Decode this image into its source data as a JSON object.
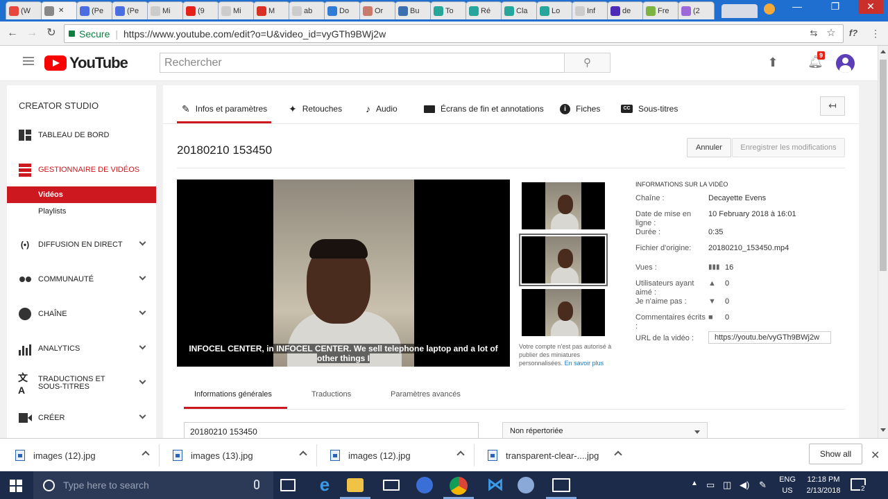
{
  "browser": {
    "tabs": [
      {
        "label": "(W",
        "color": "#e8453c"
      },
      {
        "label": "",
        "color": "#888888"
      },
      {
        "label": "(Pe",
        "color": "#4a6ee0"
      },
      {
        "label": "(Pe",
        "color": "#4a6ee0"
      },
      {
        "label": "Mi",
        "color": "#cccccc"
      },
      {
        "label": "(9",
        "color": "#e62117"
      },
      {
        "label": "Mi",
        "color": "#cccccc"
      },
      {
        "label": "M",
        "color": "#d93025"
      },
      {
        "label": "ab",
        "color": "#cccccc"
      },
      {
        "label": "Do",
        "color": "#2f7bd6"
      },
      {
        "label": "Or",
        "color": "#c97a6a"
      },
      {
        "label": "Bu",
        "color": "#3a6fb0"
      },
      {
        "label": "To",
        "color": "#26a69a"
      },
      {
        "label": "Ré",
        "color": "#26a69a"
      },
      {
        "label": "Cla",
        "color": "#26a69a"
      },
      {
        "label": "Lo",
        "color": "#26a69a"
      },
      {
        "label": "Inf",
        "color": "#cccccc"
      },
      {
        "label": "de",
        "color": "#4b2bb8"
      },
      {
        "label": "Fre",
        "color": "#7cb342"
      },
      {
        "label": "(2",
        "color": "#9c6ad8"
      }
    ],
    "url_secure": "Secure",
    "url": "https://www.youtube.com/edit?o=U&video_id=vyGTh9BWj2w"
  },
  "yt": {
    "logo": "YouTube",
    "search_placeholder": "Rechercher",
    "notif_count": "9"
  },
  "sidebar": {
    "heading": "CREATOR STUDIO",
    "items": [
      {
        "label": "TABLEAU DE BORD"
      },
      {
        "label": "GESTIONNAIRE DE VIDÉOS"
      },
      {
        "label": "DIFFUSION EN DIRECT"
      },
      {
        "label": "COMMUNAUTÉ"
      },
      {
        "label": "CHAÎNE"
      },
      {
        "label": "ANALYTICS"
      },
      {
        "label": "TRADUCTIONS ET SOUS-TITRES"
      },
      {
        "label": "CRÉER"
      }
    ],
    "sub": {
      "videos": "Vidéos",
      "playlists": "Playlists"
    }
  },
  "editor": {
    "tabs": [
      "Infos et paramètres",
      "Retouches",
      "Audio",
      "Écrans de fin et annotations",
      "Fiches",
      "Sous-titres"
    ],
    "title": "20180210 153450",
    "cancel": "Annuler",
    "save": "Enregistrer les modifications",
    "caption": "INFOCEL CENTER, in INFOCEL CENTER. We sell telephone laptop and a lot of other things I",
    "thumb_note": "Votre compte n'est pas autorisé à publier des miniatures personnalisées.",
    "thumb_link": "En savoir plus",
    "info": {
      "heading": "INFORMATIONS SUR LA VIDÉO",
      "channel_label": "Chaîne :",
      "channel": "Decayette Evens",
      "date_label": "Date de mise en ligne :",
      "date": "10 February 2018 à 16:01",
      "duration_label": "Durée :",
      "duration": "0:35",
      "file_label": "Fichier d'origine:",
      "file": "20180210_153450.mp4",
      "views_label": "Vues :",
      "views": "16",
      "likes_label": "Utilisateurs ayant aimé :",
      "likes": "0",
      "dislikes_label": "Je n'aime pas :",
      "dislikes": "0",
      "comments_label": "Commentaires écrits :",
      "comments": "0",
      "url_label": "URL de la vidéo :",
      "url": "https://youtu.be/vyGTh9BWj2w"
    },
    "bottom_tabs": [
      "Informations générales",
      "Traductions",
      "Paramètres avancés"
    ],
    "title_input": "20180210 153450",
    "privacy": "Non répertoriée"
  },
  "downloads": {
    "items": [
      "images (12).jpg",
      "images (13).jpg",
      "images (12).jpg",
      "transparent-clear-....jpg"
    ],
    "show_all": "Show all"
  },
  "taskbar": {
    "search_placeholder": "Type here to search",
    "lang": "ENG",
    "region": "US",
    "time": "12:18 PM",
    "date": "2/13/2018",
    "notif_count": "2"
  }
}
